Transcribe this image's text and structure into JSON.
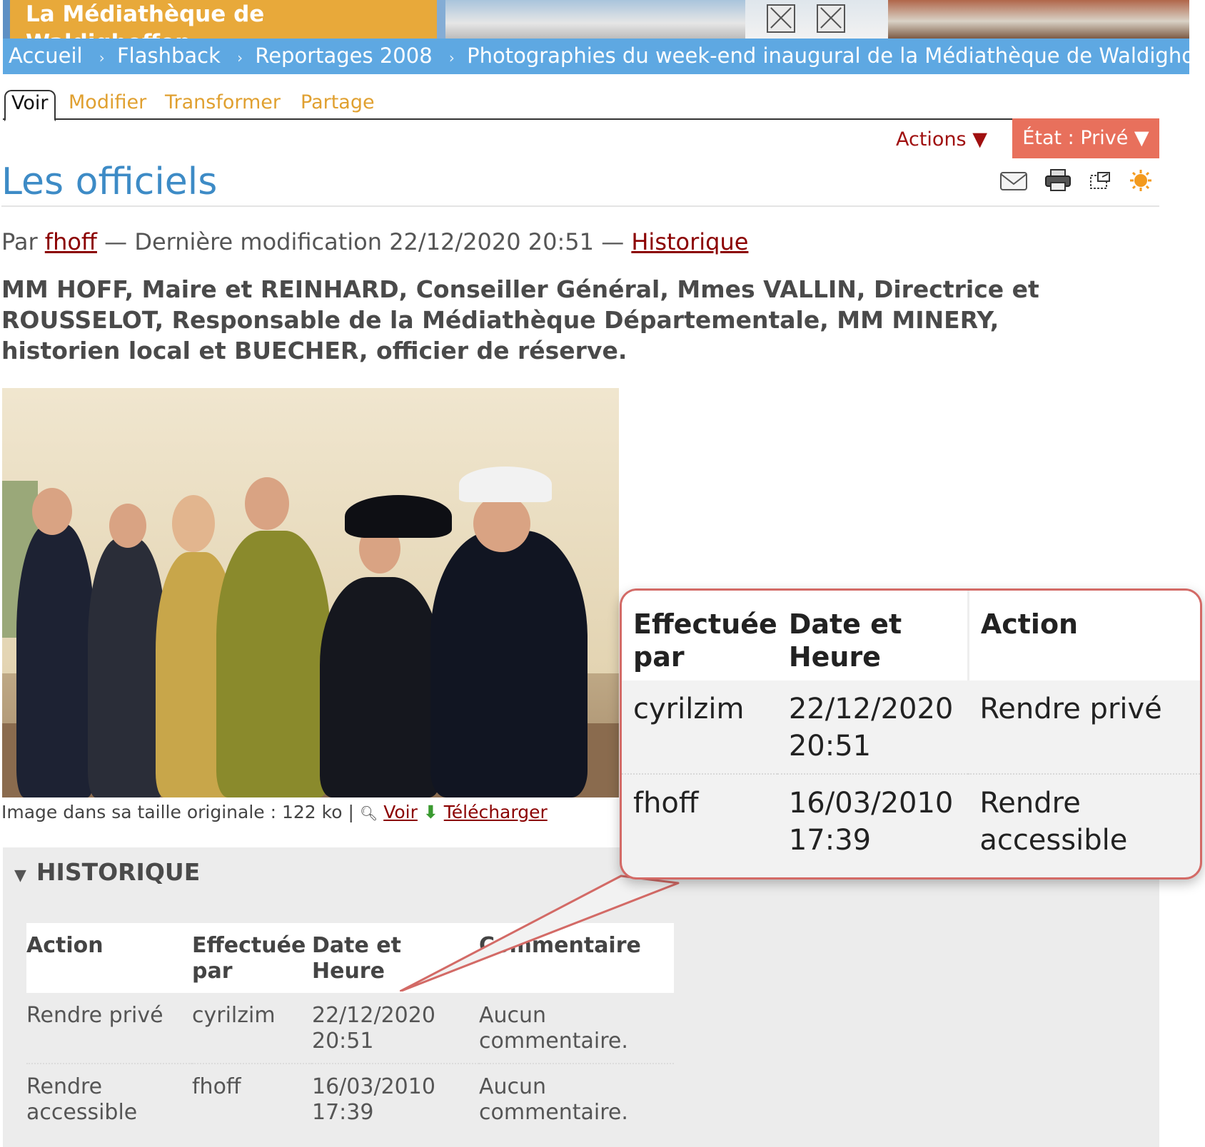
{
  "site": {
    "name": "La Médiathèque de Waldighoffen"
  },
  "breadcrumb": [
    "Accueil",
    "Flashback",
    "Reportages 2008",
    "Photographies du week-end inaugural de la Médiathèque de Waldighoffen"
  ],
  "tabs": [
    {
      "label": "Voir",
      "active": true
    },
    {
      "label": "Modifier",
      "active": false
    },
    {
      "label": "Transformer",
      "active": false
    },
    {
      "label": "Partage",
      "active": false
    }
  ],
  "menus": {
    "actions": "Actions ▼",
    "state": "État : Privé ▼"
  },
  "doc_icons": [
    "envelope-icon",
    "printer-icon",
    "fullscreen-icon",
    "rss-icon"
  ],
  "page": {
    "title": "Les officiels",
    "byline_prefix": "Par",
    "author": "fhoff",
    "modified_text": "— Dernière modification 22/12/2020 20:51 —",
    "history_link": "Historique",
    "description": "MM HOFF, Maire et REINHARD, Conseiller Général, Mmes VALLIN, Directrice et ROUSSELOT, Responsable de la Médiathèque Départementale, MM MINERY, historien local et BUECHER, officier de réserve."
  },
  "image_info": {
    "text": "Image dans sa taille originale : 122 ko  |",
    "view_label": "Voir",
    "download_label": "Télécharger"
  },
  "history": {
    "heading": "HISTORIQUE",
    "columns": [
      "Action",
      "Effectuée par",
      "Date et Heure",
      "Commentaire"
    ],
    "rows": [
      {
        "action": "Rendre privé",
        "by": "cyrilzim",
        "date": "22/12/2020",
        "time": "20:51",
        "comment": "Aucun commentaire."
      },
      {
        "action": "Rendre accessible",
        "by": "fhoff",
        "date": "16/03/2010",
        "time": "17:39",
        "comment": "Aucun commentaire."
      }
    ]
  },
  "callout": {
    "columns": [
      "Effectuée par",
      "Date et Heure",
      "Action"
    ],
    "rows": [
      {
        "by": "cyrilzim",
        "date": "22/12/2020",
        "time": "20:51",
        "action": "Rendre privé"
      },
      {
        "by": "fhoff",
        "date": "16/03/2010",
        "time": "17:39",
        "action": "Rendre accessible"
      }
    ]
  },
  "colors": {
    "banner_label": "#e8a93a",
    "breadcrumb_bar": "#5ea8e2",
    "title": "#3d8bc6",
    "state_menu": "#e8705c",
    "private_action": "#e06050",
    "public_action": "#8ccc3a",
    "link": "#8b0000",
    "callout_border": "#d36a66"
  }
}
